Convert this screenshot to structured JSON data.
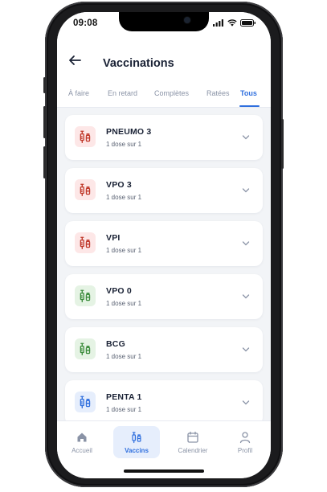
{
  "status_bar": {
    "time": "09:08"
  },
  "header": {
    "title": "Vaccinations"
  },
  "tabs": [
    {
      "label": "À faire"
    },
    {
      "label": "En retard"
    },
    {
      "label": "Complètes"
    },
    {
      "label": "Ratées"
    },
    {
      "label": "Tous"
    }
  ],
  "vaccines": [
    {
      "name": "PNEUMO 3",
      "dose": "1 dose sur 1",
      "color": "#c0392b",
      "bg": "#fde7e7"
    },
    {
      "name": "VPO 3",
      "dose": "1 dose sur 1",
      "color": "#c0392b",
      "bg": "#fde7e7"
    },
    {
      "name": "VPI",
      "dose": "1 dose sur 1",
      "color": "#c0392b",
      "bg": "#fde7e7"
    },
    {
      "name": "VPO 0",
      "dose": "1 dose sur 1",
      "color": "#3c8c3c",
      "bg": "#e5f3e4"
    },
    {
      "name": "BCG",
      "dose": "1 dose sur 1",
      "color": "#3c8c3c",
      "bg": "#e5f3e4"
    },
    {
      "name": "PENTA 1",
      "dose": "1 dose sur 1",
      "color": "#2f6fde",
      "bg": "#e6eefc"
    }
  ],
  "bottom_nav": [
    {
      "label": "Accueil",
      "icon": "home-icon"
    },
    {
      "label": "Vaccins",
      "icon": "syringe-icon"
    },
    {
      "label": "Calendrier",
      "icon": "calendar-icon"
    },
    {
      "label": "Profil",
      "icon": "user-icon"
    }
  ],
  "colors": {
    "accent": "#2f6fde",
    "text": "#1a2235",
    "muted": "#8a93a6"
  }
}
